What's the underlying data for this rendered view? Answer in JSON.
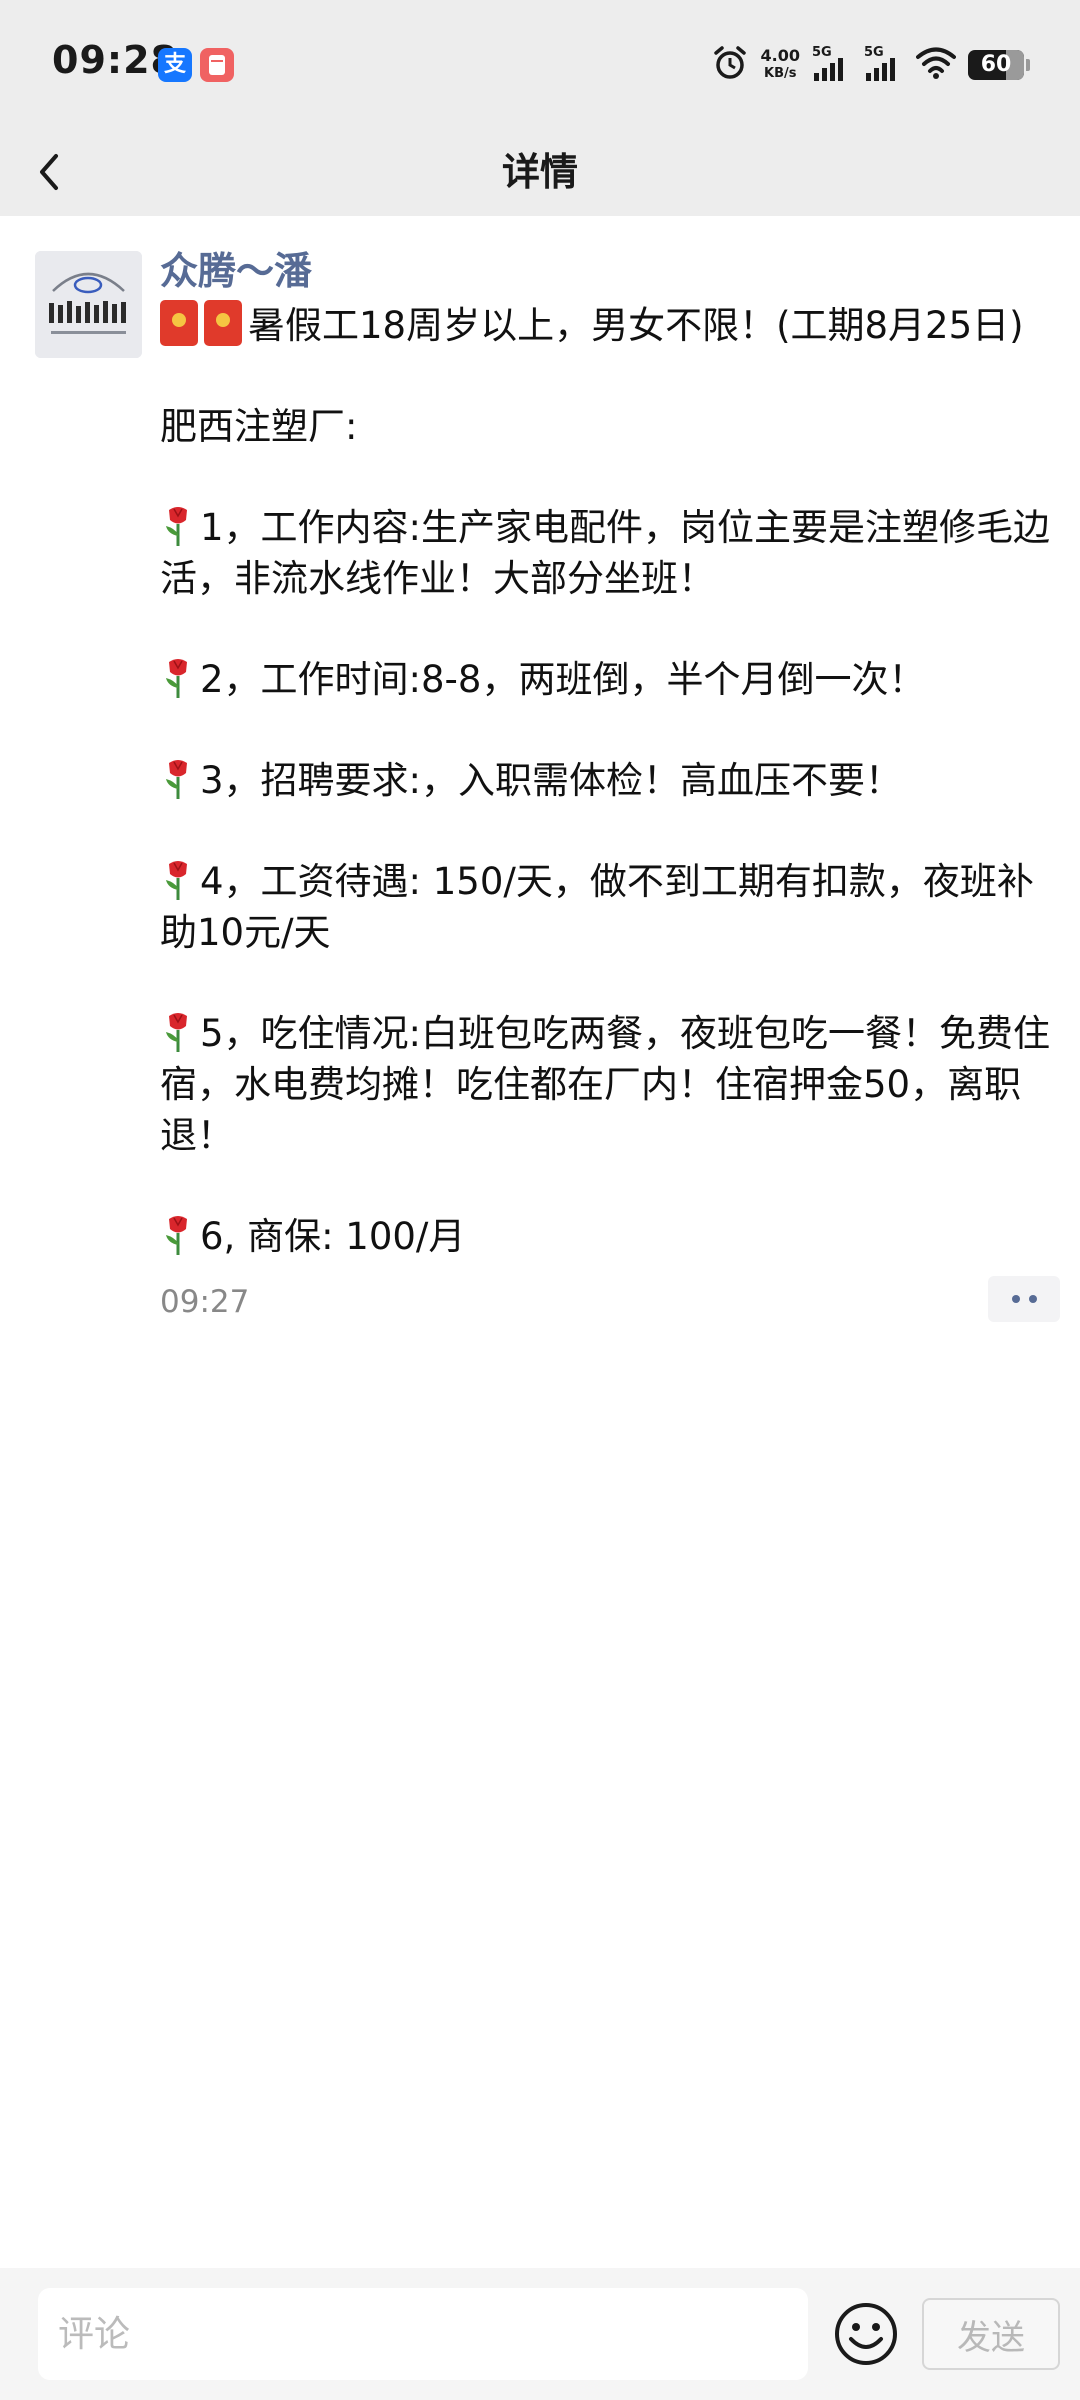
{
  "status_bar": {
    "time": "09:28",
    "alipay_icon_text": "支",
    "net_speed_value": "4.00",
    "net_speed_unit": "KB/s",
    "signal_1_label": "5G",
    "signal_2_label": "5G",
    "battery_level": "60"
  },
  "nav": {
    "title": "详情"
  },
  "post": {
    "author": "众腾～潘",
    "headline": "暑假工18周岁以上，男女不限！(工期8月25日)",
    "factory": "肥西注塑厂:",
    "items": [
      "1，工作内容:生产家电配件，岗位主要是注塑修毛边活，非流水线作业！大部分坐班！",
      "2，工作时间:8-8，两班倒，半个月倒一次！",
      "3，招聘要求:，入职需体检！高血压不要！",
      "4，工资待遇: 150/天，做不到工期有扣款，夜班补助10元/天",
      "5，吃住情况:白班包吃两餐，夜班包吃一餐！免费住宿，水电费均摊！吃住都在厂内！住宿押金50，离职退！",
      "6, 商保: 100/月"
    ],
    "time": "09:27"
  },
  "comment_bar": {
    "placeholder": "评论",
    "send_label": "发送"
  },
  "icons": {
    "back": "chevron-left-icon",
    "more": "more-dots-icon",
    "emoji": "smiley-icon",
    "red_packet": "red-packet-emoji",
    "rose": "rose-emoji"
  },
  "colors": {
    "author_name": "#576b95",
    "header_bg": "#ededed",
    "time_text": "#888888",
    "send_disabled": "#b8b8b8"
  }
}
